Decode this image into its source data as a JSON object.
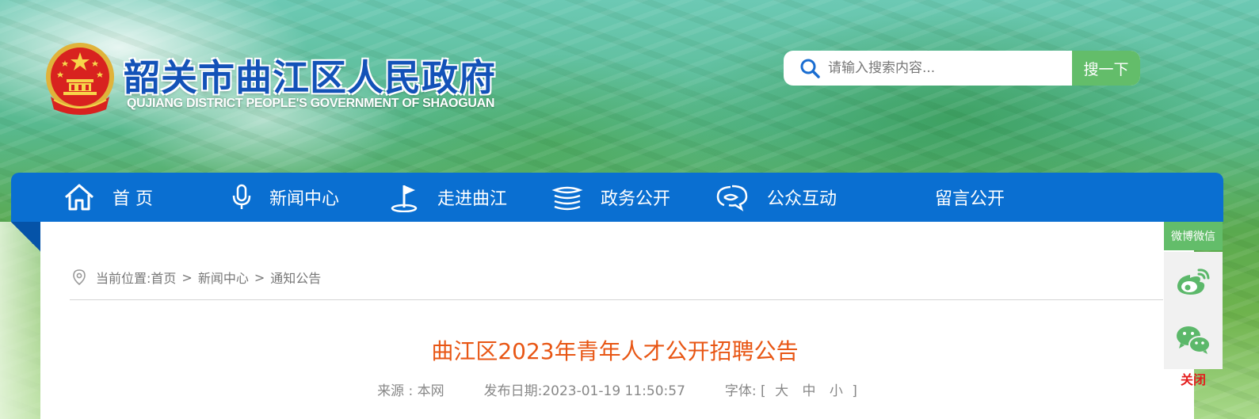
{
  "header": {
    "title": "韶关市曲江区人民政府",
    "subtitle": "QUJIANG DISTRICT PEOPLE'S GOVERNMENT OF SHAOGUAN",
    "emblem_icon": "national-emblem-icon"
  },
  "search": {
    "placeholder": "请输入搜索内容...",
    "button_label": "搜一下"
  },
  "nav": {
    "items": [
      {
        "label": "首 页",
        "icon": "home-icon"
      },
      {
        "label": "新闻中心",
        "icon": "microphone-icon"
      },
      {
        "label": "走进曲江",
        "icon": "flag-icon"
      },
      {
        "label": "政务公开",
        "icon": "stack-icon"
      },
      {
        "label": "公众互动",
        "icon": "chat-icon"
      },
      {
        "label": "留言公开",
        "icon": ""
      }
    ]
  },
  "breadcrumb": {
    "prefix": "当前位置:",
    "items": [
      "首页",
      "新闻中心",
      "通知公告"
    ],
    "separator": ">"
  },
  "article": {
    "title": "曲江区2023年青年人才公开招聘公告",
    "source": "来源 : 本网",
    "publish_date": "发布日期:2023-01-19 11:50:57",
    "font_label": "字体:",
    "font_open": "[",
    "font_options": [
      "大",
      "中",
      "小"
    ],
    "font_close": "]"
  },
  "share": {
    "header": "微博微信",
    "close": "关闭"
  },
  "colors": {
    "nav_blue": "#0a6fd1",
    "title_orange": "#e85614",
    "share_green": "#63bd6a",
    "close_red": "#e41c1c",
    "site_title_blue": "#1352b8"
  }
}
